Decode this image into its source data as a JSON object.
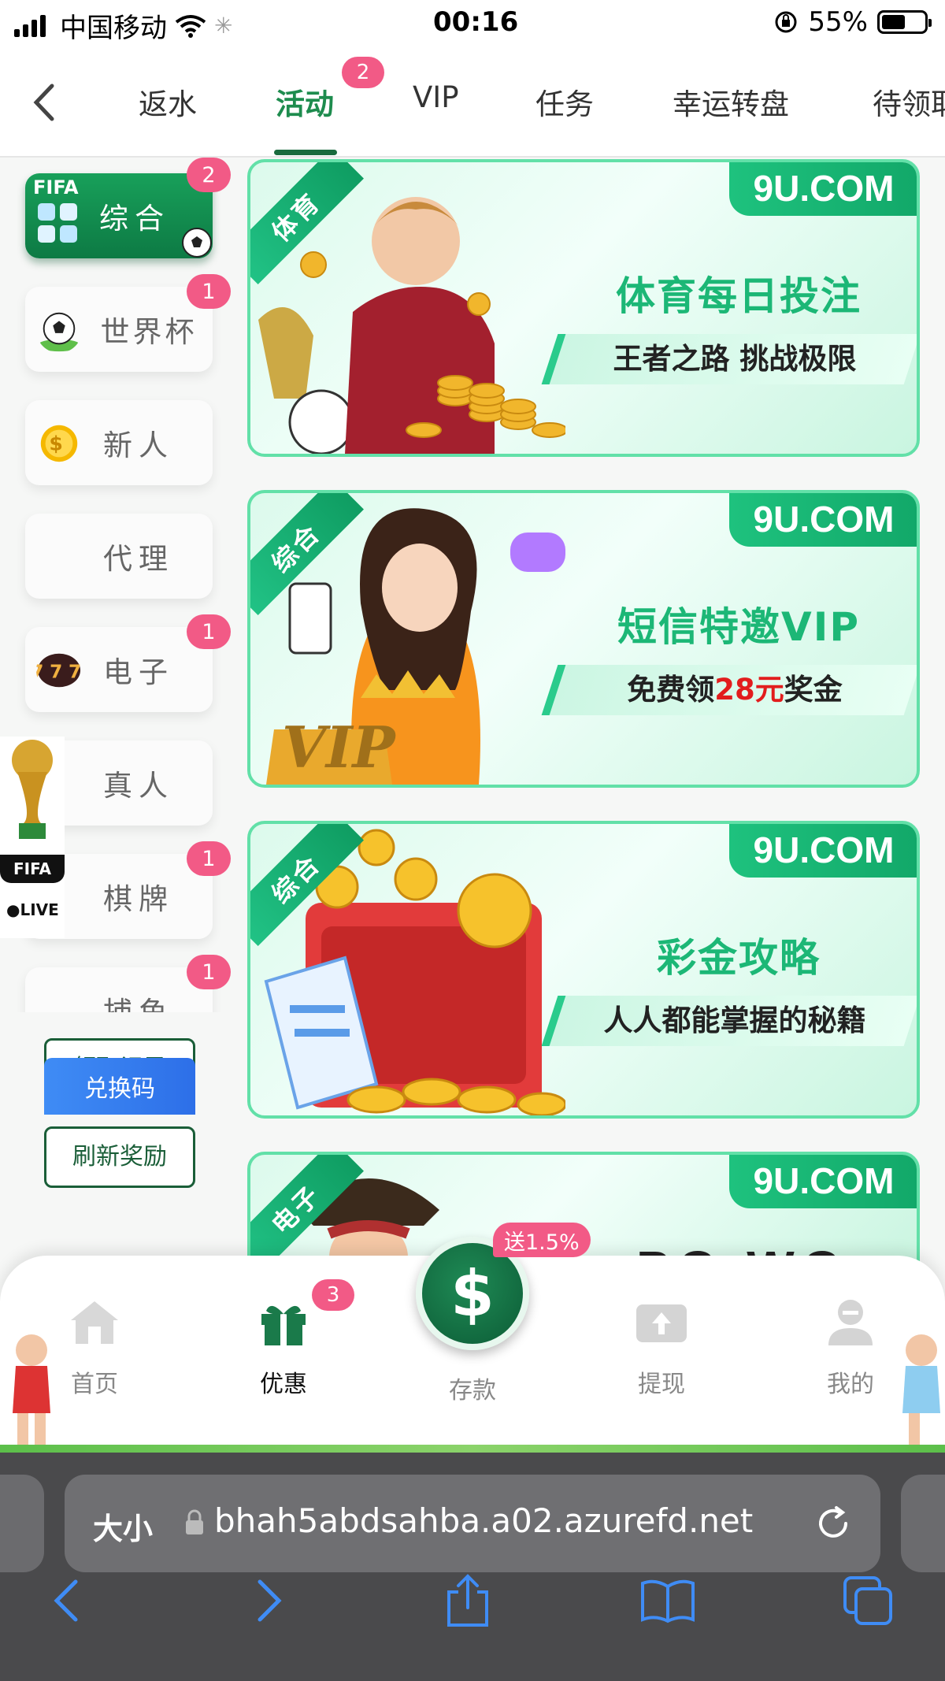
{
  "status_bar": {
    "carrier": "中国移动",
    "time": "00:16",
    "battery_percent": "55%",
    "battery_level": 0.55
  },
  "top_tabs": {
    "items": [
      {
        "label": "返水"
      },
      {
        "label": "活动",
        "badge": "2",
        "active": true
      },
      {
        "label": "VIP"
      },
      {
        "label": "任务"
      },
      {
        "label": "幸运转盘"
      },
      {
        "label": "待领取"
      }
    ]
  },
  "sidebar": {
    "items": [
      {
        "label": "综合",
        "badge": "2",
        "active": true
      },
      {
        "label": "世界杯",
        "badge": "1"
      },
      {
        "label": "新人"
      },
      {
        "label": "代理"
      },
      {
        "label": "电子",
        "badge": "1"
      },
      {
        "label": "真人"
      },
      {
        "label": "棋牌",
        "badge": "1"
      },
      {
        "label": "捕鱼",
        "badge": "1"
      }
    ],
    "fifa_badge": {
      "fifa": "FIFA",
      "live": "●LIVE"
    },
    "buttons": {
      "claim_records": "领取记录",
      "refresh_rewards": "刷新奖励",
      "redeem_code": "兑换码"
    }
  },
  "banners": [
    {
      "ribbon": "体育",
      "site": "9U.COM",
      "title": "体育每日投注",
      "subtitle": "王者之路 挑战极限"
    },
    {
      "ribbon": "综合",
      "site": "9U.COM",
      "title": "短信特邀VIP",
      "subtitle_pre": "免费领",
      "subtitle_highlight": "28元",
      "subtitle_post": "奖金",
      "art_text": "VIP"
    },
    {
      "ribbon": "综合",
      "site": "9U.COM",
      "title": "彩金攻略",
      "subtitle": "人人都能掌握的秘籍"
    },
    {
      "ribbon": "电子",
      "site": "9U.COM",
      "title_partial": "PG WG"
    }
  ],
  "bottom_nav": {
    "items": [
      {
        "label": "首页",
        "icon": "home-icon"
      },
      {
        "label": "优惠",
        "icon": "gift-icon",
        "badge": "3",
        "active": true
      },
      {
        "label": "存款",
        "icon": "deposit-icon",
        "tag": "送1.5%"
      },
      {
        "label": "提现",
        "icon": "upload-icon"
      },
      {
        "label": "我的",
        "icon": "user-icon"
      }
    ]
  },
  "safari": {
    "aa_label": "大小",
    "url": "bhah5abdsahba.a02.azurefd.net"
  },
  "colors": {
    "accent_green": "#1cb776",
    "badge_pink": "#f25a86",
    "dark_green": "#1a5e38"
  }
}
